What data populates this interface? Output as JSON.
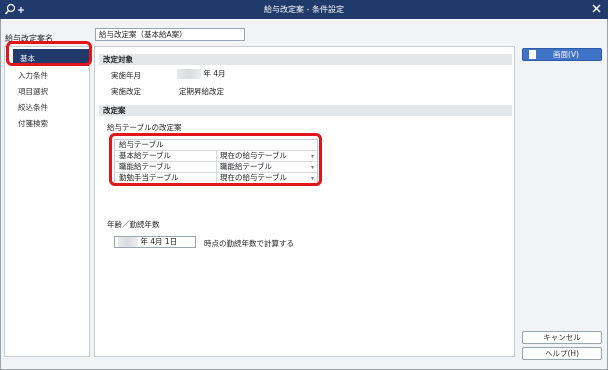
{
  "window": {
    "title": "給与改定案 - 条件設定"
  },
  "plan": {
    "label": "給与改定案名",
    "value": "給与改定案（基本給A案）"
  },
  "sidebar": {
    "items": [
      {
        "label": "基本"
      },
      {
        "label": "入力条件"
      },
      {
        "label": "項目選択"
      },
      {
        "label": "絞込条件"
      },
      {
        "label": "付箋検索"
      }
    ]
  },
  "target": {
    "header": "改定対象",
    "year_month_label": "実施年月",
    "year_month_suffix": "年 4月",
    "revision_label": "実施改定",
    "revision_value": "定期昇給改定"
  },
  "proposal": {
    "header": "改定案",
    "table_label": "給与テーブルの改定案",
    "table_title": "給与テーブル",
    "rows": [
      {
        "name": "基本給テーブル",
        "value": "現在の給与テーブル"
      },
      {
        "name": "職能給テーブル",
        "value": "職能給テーブル"
      },
      {
        "name": "勤勉手当テーブル",
        "value": "現在の給与テーブル"
      }
    ],
    "age_label": "年齢／勤続年数",
    "date_suffix": "年  4月  1日",
    "date_note": "時点の勤続年数で計算する"
  },
  "buttons": {
    "screen": "画面(V)",
    "cancel": "キャンセル",
    "help": "ヘルプ(H)"
  },
  "colors": {
    "titlebar": "#1f3a6b",
    "highlight": "#e0161b",
    "primary_button": "#3f73c8"
  }
}
